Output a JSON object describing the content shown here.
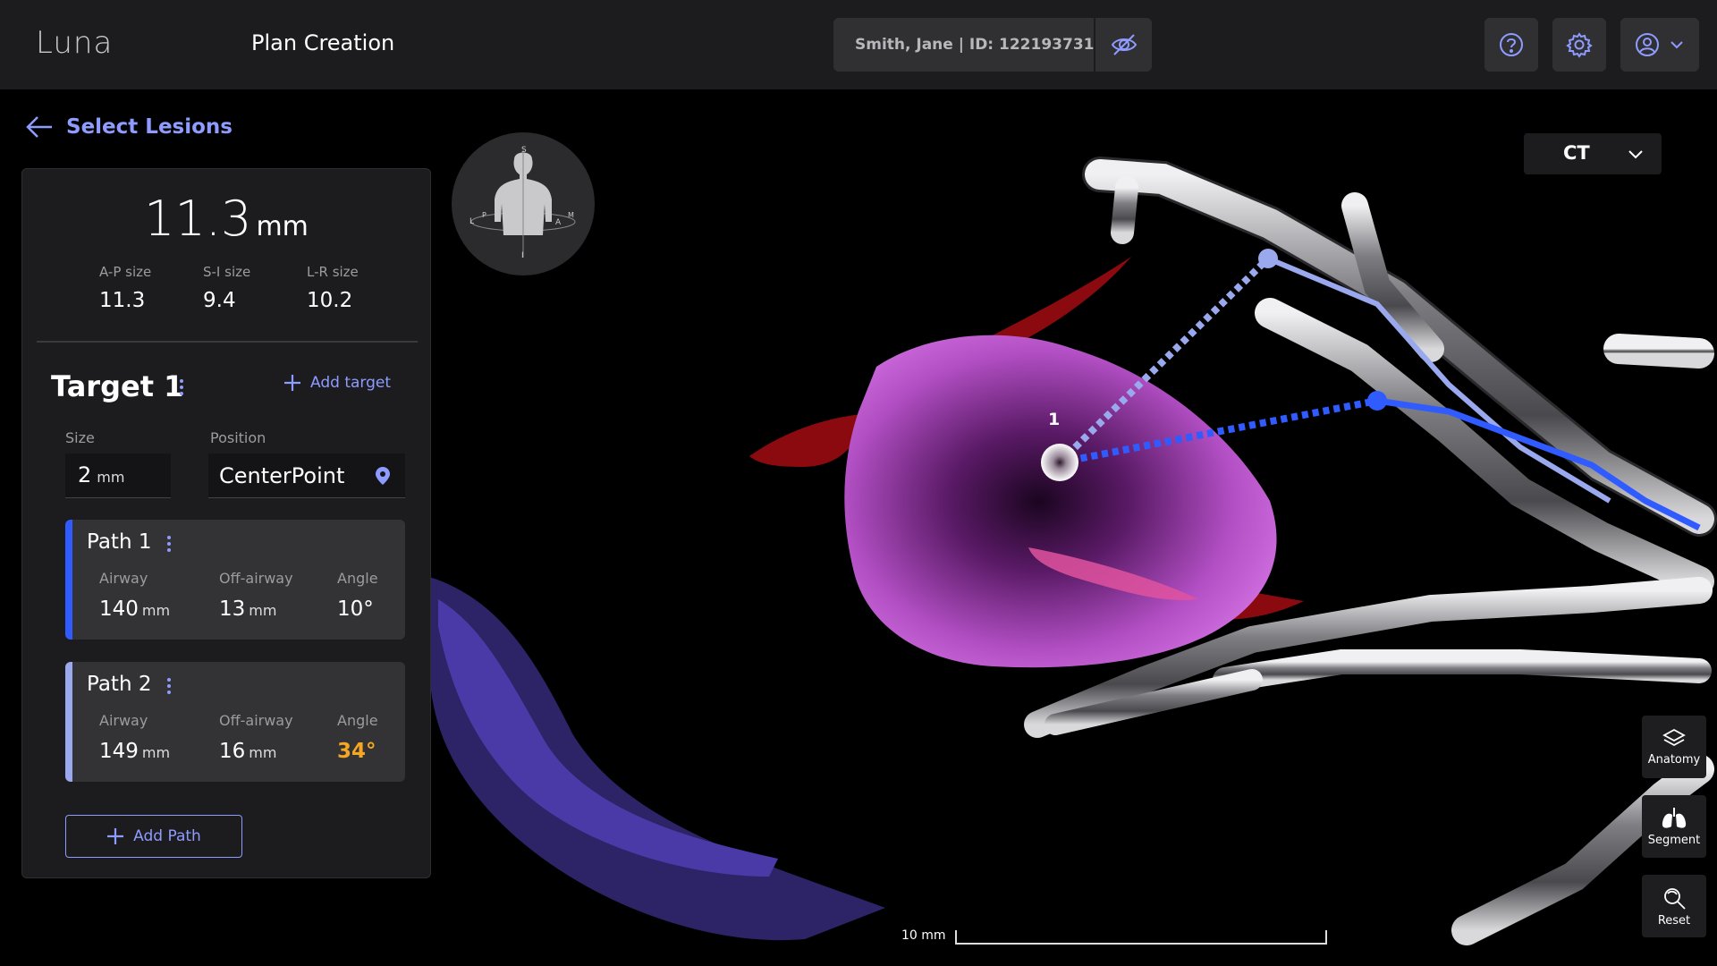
{
  "header": {
    "logo": "Luna",
    "title": "Plan Creation",
    "patient": "Smith, Jane | ID: 122193731"
  },
  "back": {
    "label": "Select Lesions"
  },
  "lesion": {
    "size": "11.3",
    "size_unit": "mm",
    "ap_label": "A-P size",
    "ap_value": "11.3",
    "si_label": "S-I size",
    "si_value": "9.4",
    "lr_label": "L-R size",
    "lr_value": "10.2"
  },
  "target": {
    "title": "Target 1",
    "add_target": "Add target",
    "size_label": "Size",
    "size_value": "2",
    "size_unit": "mm",
    "position_label": "Position",
    "position_value": "CenterPoint"
  },
  "paths": [
    {
      "title": "Path 1",
      "airway_label": "Airway",
      "airway_value": "140",
      "airway_unit": "mm",
      "off_label": "Off-airway",
      "off_value": "13",
      "off_unit": "mm",
      "angle_label": "Angle",
      "angle_value": "10°",
      "color": "#2f5bff"
    },
    {
      "title": "Path 2",
      "airway_label": "Airway",
      "airway_value": "149",
      "airway_unit": "mm",
      "off_label": "Off-airway",
      "off_value": "16",
      "off_unit": "mm",
      "angle_label": "Angle",
      "angle_value": "34°",
      "color": "#9aa8ee"
    }
  ],
  "add_path": "Add Path",
  "orientation": {
    "s": "S",
    "i": "I",
    "l": "L",
    "p": "P",
    "a": "A",
    "m": "M"
  },
  "view_mode": "CT",
  "lesion_marker": "1",
  "tools": {
    "anatomy": "Anatomy",
    "segment": "Segment",
    "reset": "Reset"
  },
  "scale": "10 mm",
  "colors": {
    "accent": "#8e9bff",
    "warning": "#f5a623",
    "lesion": "#b24fc4",
    "vessel": "#8b0a10",
    "airway": "#b9b9bd"
  }
}
